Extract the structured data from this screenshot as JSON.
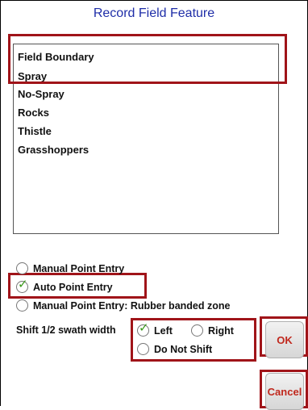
{
  "dialog": {
    "title": "Record Field Feature"
  },
  "features": {
    "items": [
      "Field Boundary",
      "Spray",
      "No-Spray",
      "Rocks",
      "Thistle",
      "Grasshoppers"
    ]
  },
  "entry_mode": {
    "options": [
      {
        "label": "Manual Point Entry",
        "selected": false
      },
      {
        "label": "Auto Point Entry",
        "selected": true
      },
      {
        "label": "Manual Point Entry: Rubber banded zone",
        "selected": false
      }
    ]
  },
  "shift": {
    "label": "Shift 1/2 swath width",
    "options": [
      {
        "label": "Left",
        "selected": true
      },
      {
        "label": "Right",
        "selected": false
      },
      {
        "label": "Do Not Shift",
        "selected": false
      }
    ]
  },
  "buttons": {
    "ok_label": "OK",
    "cancel_label": "Cancel"
  },
  "colors": {
    "title": "#1f2ea8",
    "highlight": "#a01419",
    "button_text": "#c0281d",
    "check": "#3a9a1a"
  }
}
